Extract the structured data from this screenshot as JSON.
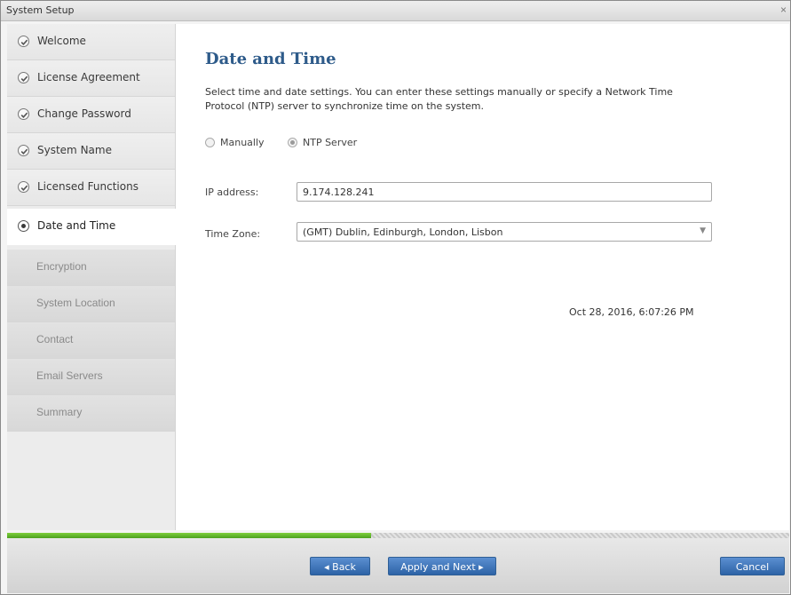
{
  "window": {
    "title": "System Setup",
    "close_glyph": "×"
  },
  "sidebar": {
    "items": [
      {
        "label": "Welcome",
        "state": "done",
        "icon": "check-circle-icon"
      },
      {
        "label": "License Agreement",
        "state": "done",
        "icon": "check-circle-icon"
      },
      {
        "label": "Change Password",
        "state": "done",
        "icon": "check-circle-icon"
      },
      {
        "label": "System Name",
        "state": "done",
        "icon": "check-circle-icon"
      },
      {
        "label": "Licensed Functions",
        "state": "done",
        "icon": "check-circle-icon"
      },
      {
        "label": "Date and Time",
        "state": "active",
        "icon": "current-step-icon"
      },
      {
        "label": "Encryption",
        "state": "pending"
      },
      {
        "label": "System Location",
        "state": "pending"
      },
      {
        "label": "Contact",
        "state": "pending"
      },
      {
        "label": "Email Servers",
        "state": "pending"
      },
      {
        "label": "Summary",
        "state": "pending"
      }
    ]
  },
  "main": {
    "title": "Date and Time",
    "description": "Select time and date settings. You can enter these settings manually or specify a Network Time Protocol (NTP) server to synchronize time on the system.",
    "mode_options": [
      {
        "label": "Manually",
        "selected": false
      },
      {
        "label": "NTP Server",
        "selected": true
      }
    ],
    "ip_label": "IP address:",
    "ip_value": "9.174.128.241",
    "tz_label": "Time Zone:",
    "tz_value": "(GMT) Dublin, Edinburgh, London, Lisbon",
    "timestamp": "Oct 28, 2016, 6:07:26 PM"
  },
  "progress": {
    "fraction": 0.465
  },
  "footer": {
    "back_label": "◂ Back",
    "apply_next_label": "Apply and Next ▸",
    "cancel_label": "Cancel"
  },
  "colors": {
    "title": "#2e5b8a",
    "button": "#2d63a6",
    "progress": "#5cb02a"
  }
}
